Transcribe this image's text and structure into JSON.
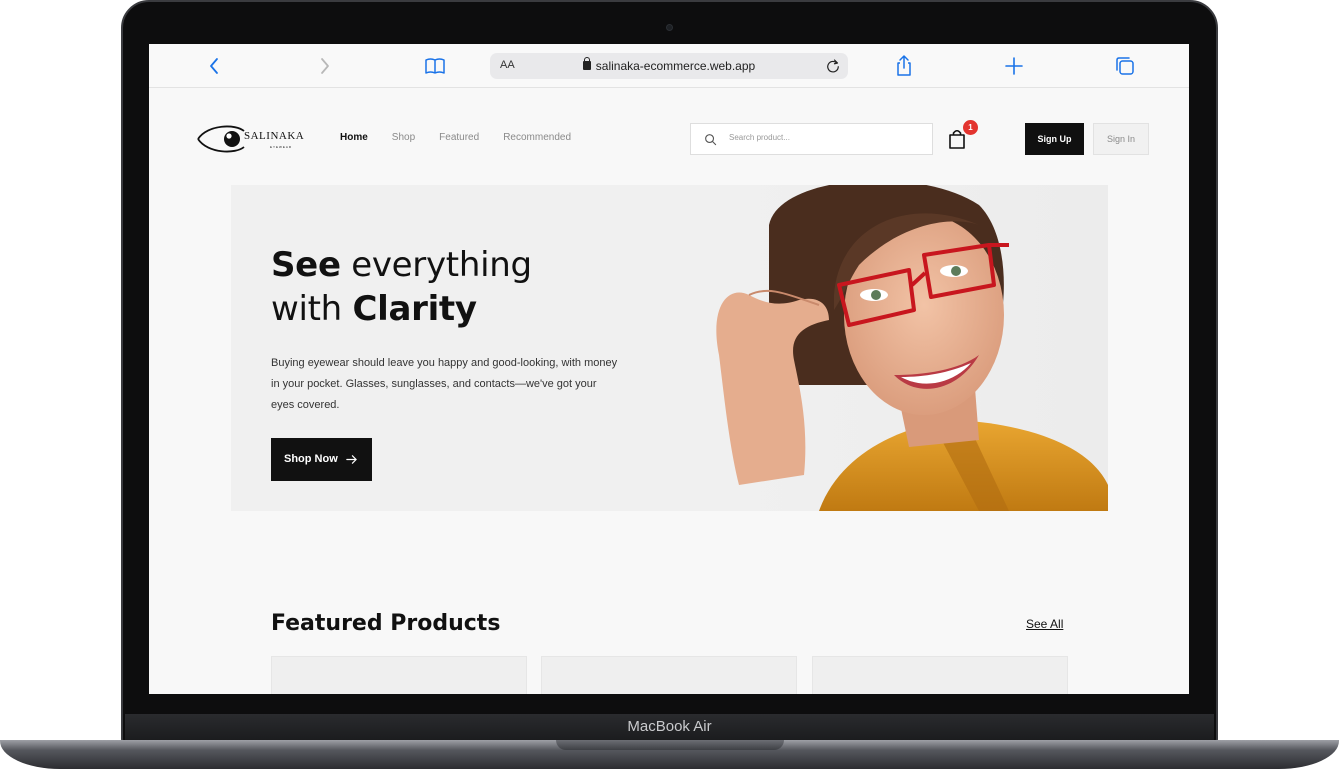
{
  "device": {
    "model_label": "MacBook Air"
  },
  "browser": {
    "address_prefix": "AA",
    "url": "salinaka-ecommerce.web.app"
  },
  "site": {
    "logo": {
      "name": "SALINAKA",
      "tagline": "EYEWEAR"
    },
    "nav": [
      {
        "label": "Home",
        "active": true
      },
      {
        "label": "Shop",
        "active": false
      },
      {
        "label": "Featured",
        "active": false
      },
      {
        "label": "Recommended",
        "active": false
      }
    ],
    "search": {
      "placeholder": "Search product..."
    },
    "cart": {
      "count": "1"
    },
    "auth": {
      "sign_up": "Sign Up",
      "sign_in": "Sign In"
    }
  },
  "hero": {
    "title_strong_1": "See",
    "title_rest_1": " everything",
    "title_pre_2": "with ",
    "title_strong_2": "Clarity",
    "description": "Buying eyewear should leave you happy and good-looking, with money in your pocket. Glasses, sunglasses, and contacts—we've got your eyes covered.",
    "cta": "Shop Now"
  },
  "featured": {
    "title": "Featured Products",
    "see_all": "See All"
  },
  "colors": {
    "primary": "#101010",
    "badge": "#e3342f",
    "background": "#f8f8f8",
    "safari_accent": "#1a73e8"
  }
}
